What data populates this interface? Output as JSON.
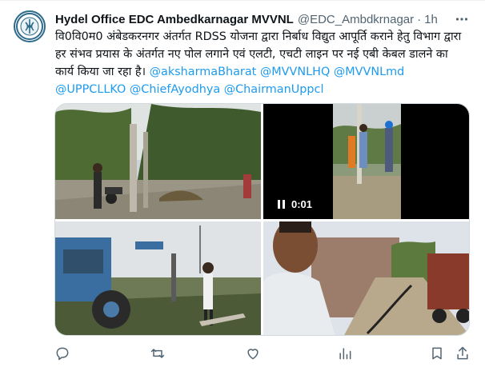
{
  "tweet": {
    "author_name": "Hydel Office EDC Ambedkarnagar MVVNL",
    "handle": "@EDC_Ambdkrnagar",
    "separator": "·",
    "time": "1h",
    "text": "वि0वि0म0 अंबेडकरनगर अंतर्गत RDSS योजना द्वारा निर्बाध विद्युत आपूर्ति कराने हेतु विभाग द्वारा हर संभव प्रयास के अंतर्गत नए पोल लगाने एवं एलटी, एचटी लाइन पर नई एबी केबल डालने का कार्य किया जा रहा है।",
    "mentions": "@aksharmaBharat @MVVNLHQ @MVVNLmd @UPPCLLKO @ChiefAyodhya @ChairmanUppcl"
  },
  "media": {
    "video_time": "0:01"
  },
  "actions": {
    "reply_icon": "reply-icon",
    "retweet_icon": "retweet-icon",
    "like_icon": "like-icon",
    "views_icon": "views-icon",
    "bookmark_icon": "bookmark-icon",
    "share_icon": "share-icon"
  },
  "colors": {
    "link": "#1d9bf0",
    "muted": "#536471",
    "text": "#0f1419"
  }
}
